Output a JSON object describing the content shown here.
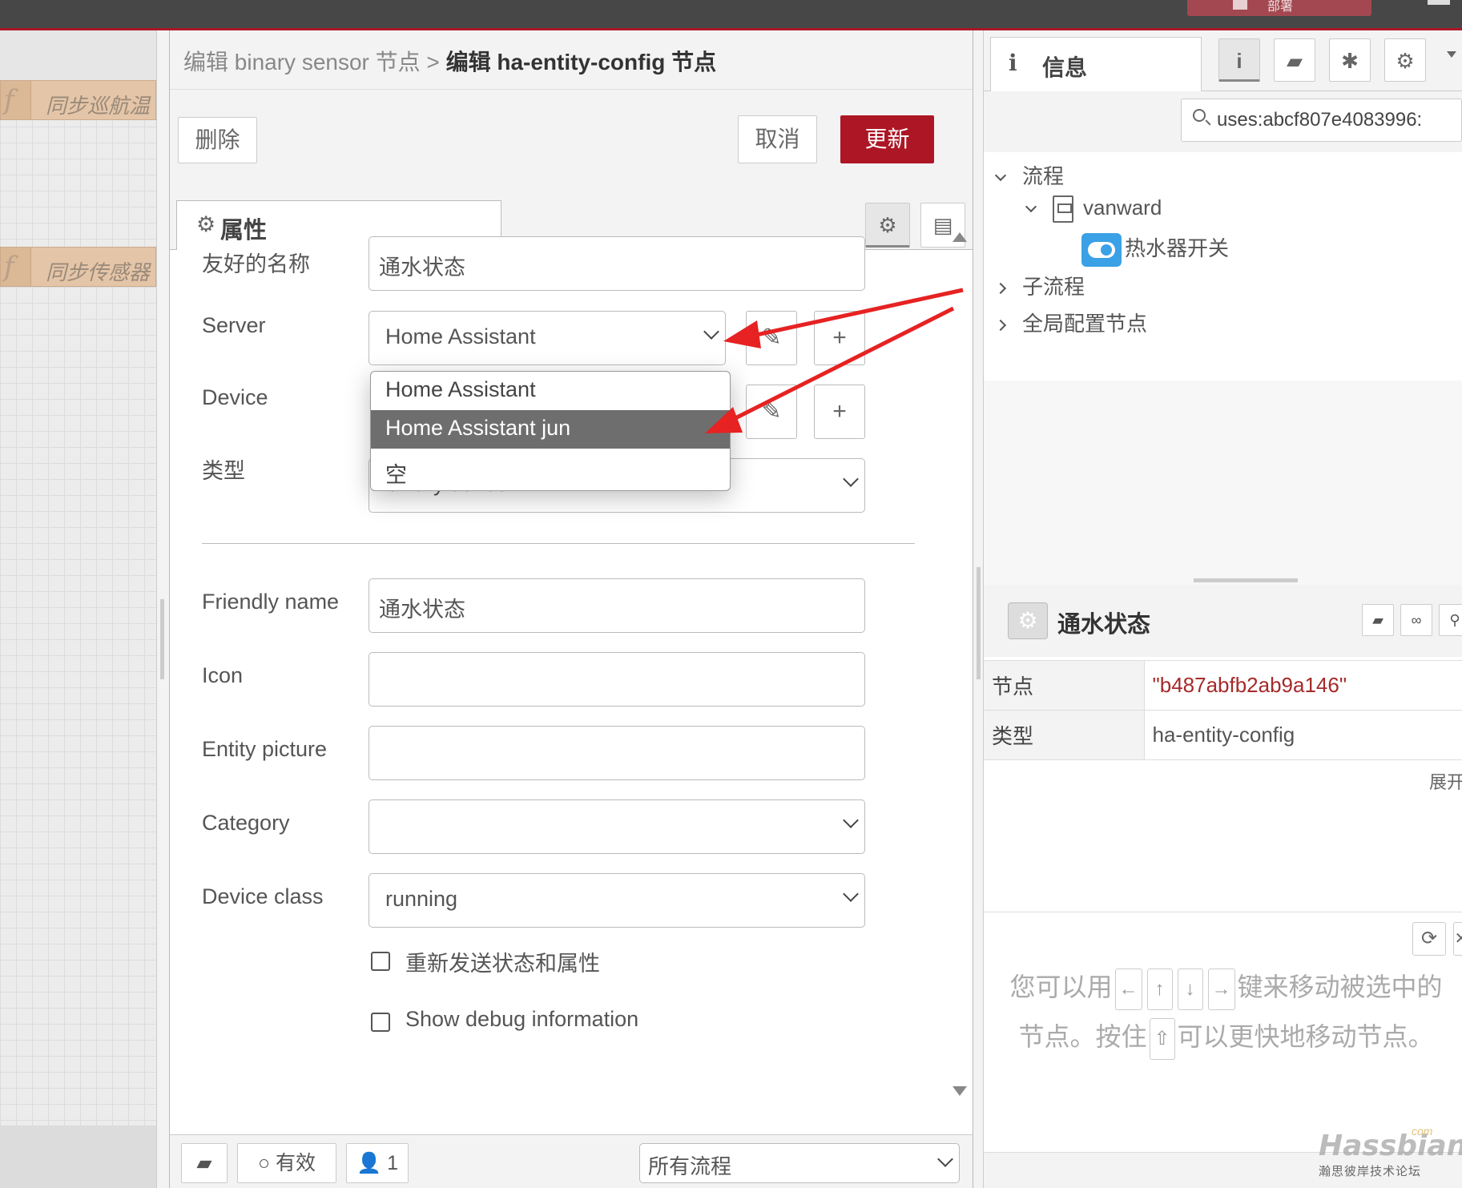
{
  "topbar": {
    "deploy_label": "部署"
  },
  "canvas": {
    "nodes": [
      {
        "icon": "function-icon",
        "label": "同步巡航温"
      },
      {
        "icon": "function-icon",
        "label": "同步传感器"
      }
    ]
  },
  "editor": {
    "breadcrumb_parent": "编辑 binary sensor 节点 >",
    "breadcrumb_current": "编辑 ha-entity-config 节点",
    "delete_label": "删除",
    "cancel_label": "取消",
    "update_label": "更新",
    "tab_label": "属性",
    "fields": {
      "friendly_name_cn_label": "友好的名称",
      "friendly_name_cn_value": "通水状态",
      "server_label": "Server",
      "server_value": "Home Assistant",
      "device_label": "Device",
      "type_label": "类型",
      "type_value": "binary sensor",
      "friendly_name_label": "Friendly name",
      "friendly_name_value": "通水状态",
      "icon_label": "Icon",
      "icon_value": "",
      "entity_picture_label": "Entity picture",
      "entity_picture_value": "",
      "category_label": "Category",
      "category_value": "",
      "device_class_label": "Device class",
      "device_class_value": "running",
      "resend_label": "重新发送状态和属性",
      "debug_label": "Show debug information"
    },
    "server_dropdown": {
      "options": [
        "Home Assistant",
        "Home Assistant jun",
        "空"
      ],
      "highlighted": "Home Assistant jun"
    },
    "footer": {
      "enabled_label": "有效",
      "users_count": "1",
      "scope_value": "所有流程"
    }
  },
  "sidebar": {
    "tab_label": "信息",
    "search_value": "uses:abcf807e4083996:",
    "tree": {
      "flows_label": "流程",
      "flow_name": "vanward",
      "node_name": "热水器开关",
      "subflows_label": "子流程",
      "global_config_label": "全局配置节点"
    },
    "info": {
      "title": "通水状态",
      "rows": [
        {
          "key": "节点",
          "value": "\"b487abfb2ab9a146\""
        },
        {
          "key": "类型",
          "value": "ha-entity-config"
        }
      ],
      "expand_label": "展开"
    },
    "help": {
      "part1": "您可以用",
      "key_left": "←",
      "key_up": "↑",
      "key_down": "↓",
      "key_right": "→",
      "part2": "键来移动被选中的节点。按住",
      "key_shift": "⇧",
      "part3": "可以更快地移动节点。"
    }
  },
  "watermark": {
    "brand": "Hassbian",
    "com": "com",
    "sub": "瀚思彼岸技术论坛"
  },
  "colors": {
    "accent": "#ad1625",
    "highlight": "#6e6e6e",
    "annotation_arrow": "#e62222",
    "toggle_icon": "#3aa1e6"
  }
}
